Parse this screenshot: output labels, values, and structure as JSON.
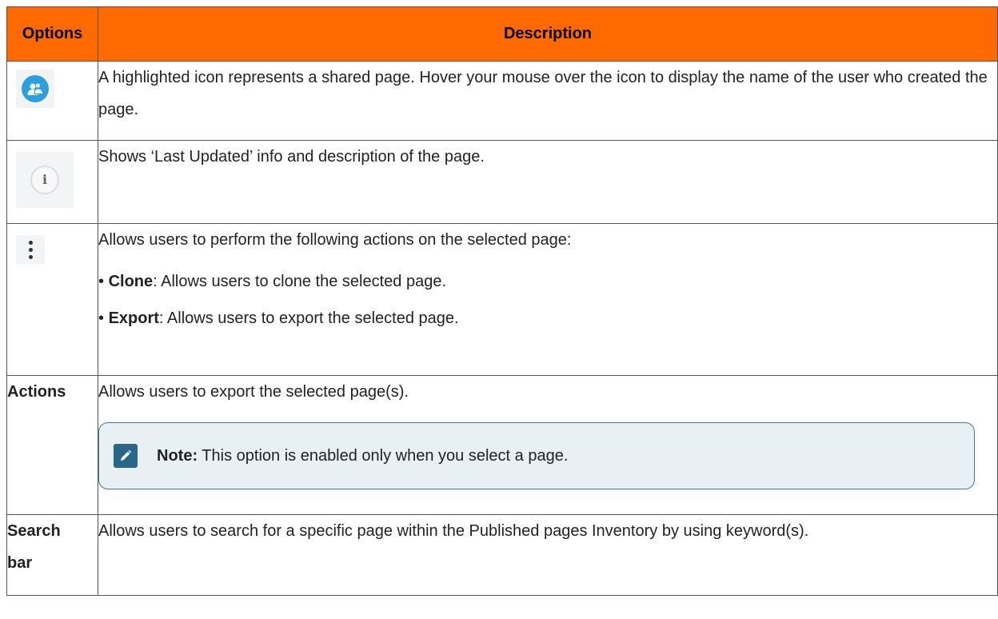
{
  "table": {
    "header": {
      "options": "Options",
      "description": "Description"
    },
    "rows": [
      {
        "icon": "shared-page-icon",
        "description": "A highlighted icon represents a shared page. Hover your mouse over the icon to display the name of the user who created the page."
      },
      {
        "icon": "info-icon",
        "description": "Shows ‘Last Updated’ info and description of the page."
      },
      {
        "icon": "more-options-icon",
        "description": "Allows users to perform the following actions on the selected page:",
        "bullets": [
          {
            "term": "Clone",
            "text": ": Allows users to clone the selected page."
          },
          {
            "term": "Export",
            "text": ": Allows users to export the selected page."
          }
        ]
      },
      {
        "label": "Actions",
        "description": "Allows users to export the selected page(s).",
        "note": {
          "label": "Note:",
          "text": " This option is enabled only when you select a page."
        }
      },
      {
        "label_line1": "Search",
        "label_line2": "bar",
        "description": "Allows users to search for a specific page within the Published pages Inventory by using keyword(s)."
      }
    ]
  },
  "colors": {
    "header_bg": "#ff6a00",
    "shared_icon": "#2b9fe0",
    "note_bg": "#e8f0f4",
    "note_border": "#3e7a9a",
    "note_icon": "#29678a"
  }
}
